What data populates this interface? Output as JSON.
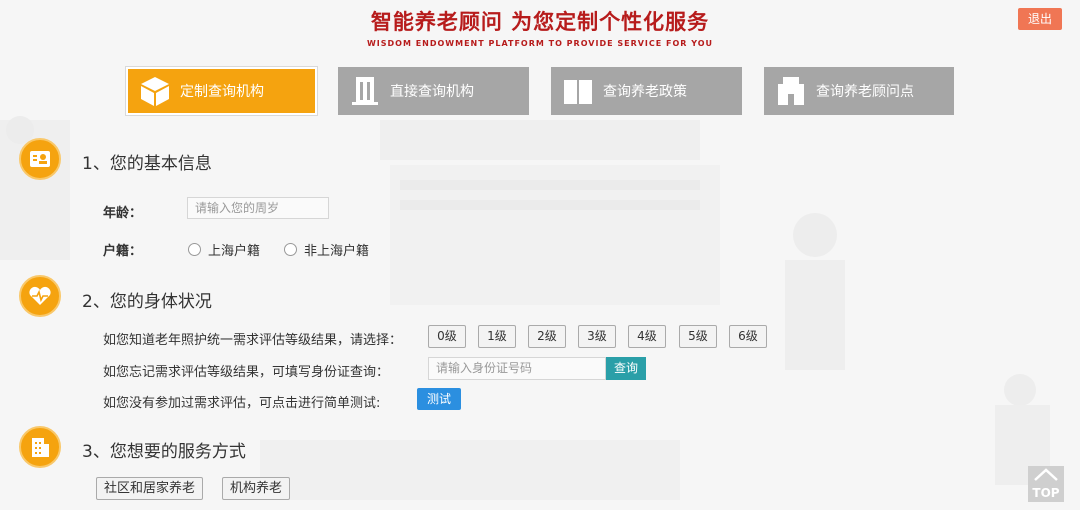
{
  "header": {
    "title": "智能养老顾问 为您定制个性化服务",
    "subtitle": "WISDOM ENDOWMENT PLATFORM TO PROVIDE SERVICE FOR YOU",
    "logout_label": "退出"
  },
  "nav": {
    "tabs": [
      {
        "label": "定制查询机构",
        "icon": "cube-icon",
        "active": true
      },
      {
        "label": "直接查询机构",
        "icon": "building-icon",
        "active": false
      },
      {
        "label": "查询养老政策",
        "icon": "book-icon",
        "active": false
      },
      {
        "label": "查询养老顾问点",
        "icon": "office-icon",
        "active": false
      }
    ]
  },
  "section1": {
    "title": "1、您的基本信息",
    "icon": "id-card-icon",
    "age_label": "年龄：",
    "age_placeholder": "请输入您的周岁",
    "hukou_label": "户籍：",
    "hukou_options": [
      "上海户籍",
      "非上海户籍"
    ]
  },
  "section2": {
    "title": "2、您的身体状况",
    "icon": "heartbeat-icon",
    "level_prompt": "如您知道老年照护统一需求评估等级结果，请选择：",
    "levels": [
      "0级",
      "1级",
      "2级",
      "3级",
      "4级",
      "5级",
      "6级"
    ],
    "forgot_prompt": "如您忘记需求评估等级结果，可填写身份证查询：",
    "id_placeholder": "请输入身份证号码",
    "query_label": "查询",
    "test_prompt": "如您没有参加过需求评估，可点击进行简单测试:",
    "test_label": "测试"
  },
  "section3": {
    "title": "3、您想要的服务方式",
    "icon": "building-list-icon",
    "options": [
      "社区和居家养老",
      "机构养老"
    ]
  },
  "top_button": {
    "label": "TOP",
    "icon": "home-outline-icon"
  },
  "colors": {
    "accent": "#f5a30f",
    "title_red": "#b71c1c",
    "logout": "#f07654",
    "nav_inactive": "#a6a6a6",
    "query": "#2a9fa8",
    "test": "#2b8fe0"
  }
}
